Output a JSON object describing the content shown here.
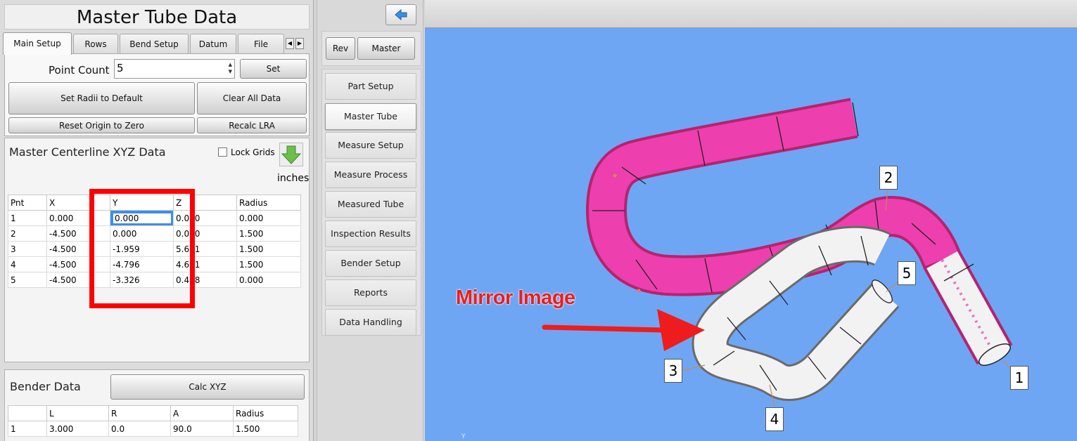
{
  "app": {
    "title": "Master Tube Data"
  },
  "tabs": [
    {
      "label": "Main Setup",
      "active": true
    },
    {
      "label": "Rows"
    },
    {
      "label": "Bend Setup"
    },
    {
      "label": "Datum"
    },
    {
      "label": "File"
    }
  ],
  "main_setup": {
    "point_count_label": "Point Count",
    "point_count_value": "5",
    "set_button": "Set",
    "set_radii_button": "Set Radii to Default",
    "clear_all_button": "Clear All Data",
    "reset_origin_button": "Reset Origin to Zero",
    "recalc_lra_button": "Recalc LRA"
  },
  "centerline": {
    "title": "Master Centerline XYZ Data",
    "lock_grids_label": "Lock Grids",
    "units": "inches",
    "columns": [
      "Pnt",
      "X",
      "Y",
      "Z",
      "Radius"
    ],
    "rows": [
      [
        "1",
        "0.000",
        "0.000",
        "0.000",
        "0.000"
      ],
      [
        "2",
        "-4.500",
        "0.000",
        "0.000",
        "1.500"
      ],
      [
        "3",
        "-4.500",
        "-1.959",
        "5.611",
        "1.500"
      ],
      [
        "4",
        "-4.500",
        "-4.796",
        "4.691",
        "1.500"
      ],
      [
        "5",
        "-4.500",
        "-3.326",
        "0.438",
        "0.000"
      ]
    ],
    "highlight_color": "#ff0000"
  },
  "bender": {
    "title": "Bender Data",
    "calc_button": "Calc XYZ",
    "columns": [
      "",
      "L",
      "R",
      "A",
      "Radius"
    ],
    "rows": [
      [
        "1",
        "3.000",
        "0.0",
        "90.0",
        "1.500"
      ]
    ]
  },
  "nav": {
    "rev_button": "Rev",
    "master_button": "Master",
    "items": [
      {
        "label": "Part Setup"
      },
      {
        "label": "Master Tube",
        "active": true
      },
      {
        "label": "Measure Setup"
      },
      {
        "label": "Measure Process"
      },
      {
        "label": "Measured Tube"
      },
      {
        "label": "Inspection Results"
      },
      {
        "label": "Bender Setup"
      },
      {
        "label": "Reports"
      },
      {
        "label": "Data Handling"
      }
    ]
  },
  "viewport": {
    "annotation": "Mirror Image",
    "point_labels": [
      "1",
      "2",
      "3",
      "4",
      "5"
    ],
    "axis_label": "Y",
    "background_color": "#6ea6f4",
    "magenta_tube_color": "#ee3fae",
    "white_tube_color": "#f2f2f2",
    "arrow_color": "#ee1c1c"
  }
}
